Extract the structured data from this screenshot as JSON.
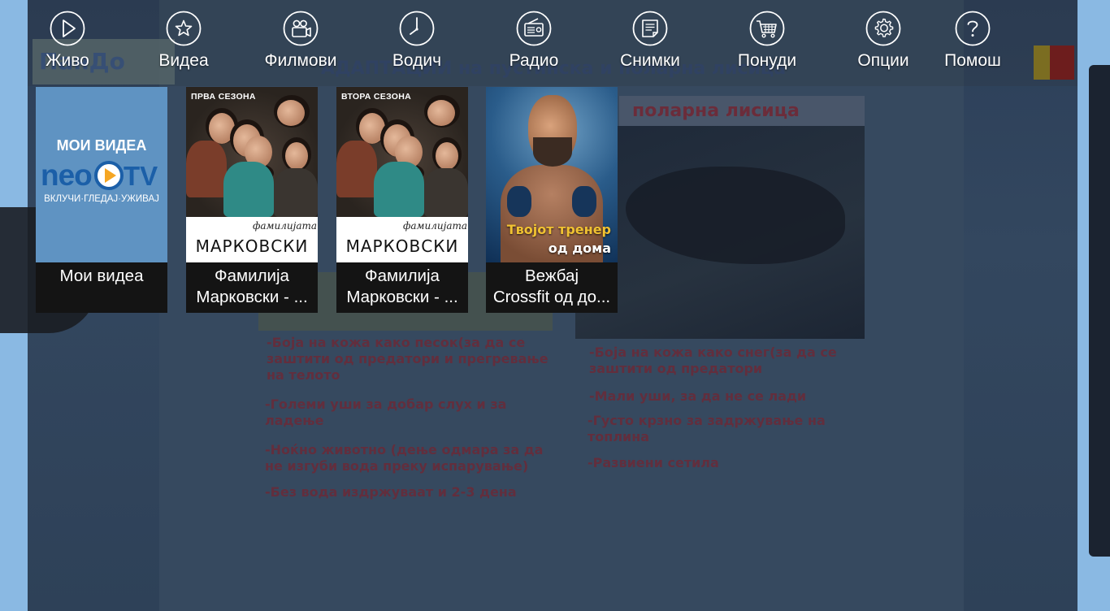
{
  "menu": {
    "items": [
      {
        "label": "Живо",
        "icon": "play-icon"
      },
      {
        "label": "Видеа",
        "icon": "star-icon"
      },
      {
        "label": "Филмови",
        "icon": "movie-camera-icon"
      },
      {
        "label": "Водич",
        "icon": "clock-icon"
      },
      {
        "label": "Радио",
        "icon": "radio-icon"
      },
      {
        "label": "Снимки",
        "icon": "recordings-icon"
      },
      {
        "label": "Понуди",
        "icon": "shopping-cart-icon"
      },
      {
        "label": "Опции",
        "icon": "gear-icon"
      },
      {
        "label": "Помош",
        "icon": "question-icon"
      }
    ]
  },
  "tiles": [
    {
      "caption": "Мои видеа",
      "thumb": {
        "title": "МОИ ВИДЕА",
        "logo_left": "neo",
        "logo_right": "TV",
        "slogan": "ВКЛУЧИ·ГЛЕДАЈ·УЖИВАЈ"
      }
    },
    {
      "caption": "Фамилија\nМарковски - ...",
      "thumb": {
        "season": "ПРВА СЕЗОНА",
        "script": "фамилијата",
        "name": "МАРКОВСКИ"
      }
    },
    {
      "caption": "Фамилија\nМарковски - ...",
      "thumb": {
        "season": "ВТОРА СЕЗОНА",
        "script": "фамилијата",
        "name": "МАРКОВСКИ"
      }
    },
    {
      "caption": "Вежбај\nCrossfit од до...",
      "thumb": {
        "line1": "Твојот тренер",
        "line2": "од дома"
      }
    }
  ],
  "background": {
    "heading": "АДАПТАЦИИ на пустинска и поларна лисица",
    "brand": "ПанДо",
    "fox_label": "поларна лисица",
    "left_notes": [
      "-Боја на кожа како песок(за да се заштити од предатори и прегревање на телото",
      "-Големи уши за добар слух и за ладење",
      "-Ноќно животно (дење одмара за да не изгуби вода преку испарување)",
      "-Без вода издржуваат и 2-3 дена"
    ],
    "right_notes": [
      "-Боја на кожа како снег(за да се заштити од предатори",
      "-Мали уши, за да не се лади",
      "-Густо крзно за задржување на топлина",
      "-Развиени сетила"
    ]
  },
  "colors": {
    "menu_text": "#ffffff",
    "tile_bg": "#141414",
    "logo_blue": "#1b5fa8",
    "logo_orange": "#f5a623",
    "crossfit_yellow": "#f1c232"
  }
}
